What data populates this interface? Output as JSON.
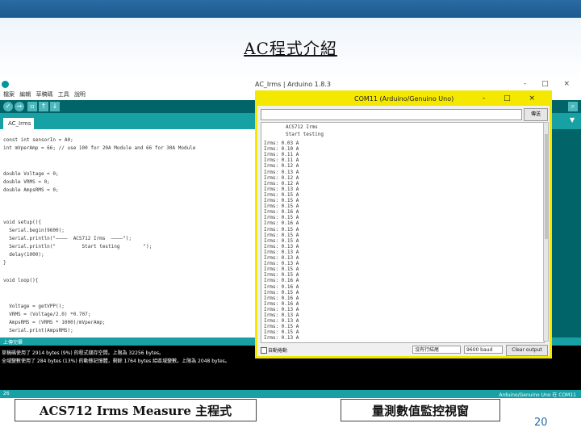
{
  "slide": {
    "title": "AC程式介紹",
    "label_left": "ACS712 Irms Measure 主程式",
    "label_right": "量測數值監控視窗",
    "page_number": "20"
  },
  "ide": {
    "window_title": "AC_Irms | Arduino 1.8.3",
    "window_buttons": "- □ ×",
    "menu": [
      "檔案",
      "編輯",
      "草稿碼",
      "工具",
      "說明"
    ],
    "tab": "AC_Irms",
    "code": [
      "const int sensorIn = A0;",
      "int mVperAmp = 66; // use 100 for 20A Module and 66 for 30A Module",
      "",
      "double Voltage = 0;",
      "double VRMS = 0;",
      "double AmpsRMS = 0;",
      "",
      "",
      "void setup(){",
      "  Serial.begin(9600);",
      "  Serial.println(\"————  ACS712 Irms  ————\");",
      "  Serial.println(\"         Start testing        \");",
      "  delay(1000);",
      "}",
      "",
      "void loop(){",
      "",
      "",
      "  Voltage = getVPP();",
      "  VRMS = (Voltage/2.0) *0.707;",
      "  AmpsRMS = (VRMS * 1000)/mVperAmp;",
      "  Serial.print(AmpsRMS);"
    ],
    "console_header": "上傳完畢",
    "console_lines": [
      "草稿碼使用了 2914 bytes (9%) 的程式儲存空間。上限為 32256 bytes。",
      "全域變數使用了 284 bytes (13%) 的動態記憶體，剩餘 1764 bytes 給區域變數。上限為 2048 bytes。"
    ],
    "status_left": "26",
    "status_right": "Arduino/Genuino Uno 在 COM11"
  },
  "serial_monitor": {
    "title": "COM11 (Arduino/Genuino Uno)",
    "title_buttons": "- □ ×",
    "send_label": "傳送",
    "header_lines": [
      "ACS712 Irms",
      "Start testing"
    ],
    "readings": [
      "Irms: 0.03 A",
      "Irms: 0.10 A",
      "Irms: 0.11 A",
      "Irms: 0.11 A",
      "Irms: 0.12 A",
      "Irms: 0.13 A",
      "Irms: 0.12 A",
      "Irms: 0.12 A",
      "Irms: 0.13 A",
      "Irms: 0.15 A",
      "Irms: 0.15 A",
      "Irms: 0.15 A",
      "Irms: 0.16 A",
      "Irms: 0.15 A",
      "Irms: 0.16 A",
      "Irms: 0.15 A",
      "Irms: 0.15 A",
      "Irms: 0.15 A",
      "Irms: 0.13 A",
      "Irms: 0.13 A",
      "Irms: 0.13 A",
      "Irms: 0.13 A",
      "Irms: 0.15 A",
      "Irms: 0.15 A",
      "Irms: 0.16 A",
      "Irms: 0.16 A",
      "Irms: 0.15 A",
      "Irms: 0.16 A",
      "Irms: 0.16 A",
      "Irms: 0.13 A",
      "Irms: 0.13 A",
      "Irms: 0.13 A",
      "Irms: 0.15 A",
      "Irms: 0.15 A",
      "Irms: 0.13 A"
    ],
    "autoscroll_label": "自動捲動",
    "line_ending": "沒有行結尾",
    "baud": "9600 baud",
    "clear_label": "Clear output"
  }
}
